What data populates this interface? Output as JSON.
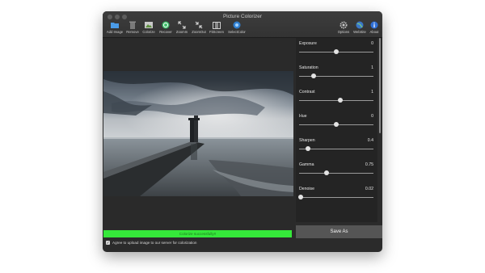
{
  "window": {
    "title": "Picture Colorizer"
  },
  "toolbar": {
    "items": [
      {
        "label": "Add Image",
        "icon": "folder-icon"
      },
      {
        "label": "Remove",
        "icon": "trash-icon"
      },
      {
        "label": "Colorize",
        "icon": "picture-icon"
      },
      {
        "label": "Recover",
        "icon": "recover-icon"
      },
      {
        "label": "ZoomIn",
        "icon": "zoom-in-icon"
      },
      {
        "label": "ZoomOut",
        "icon": "zoom-out-icon"
      },
      {
        "label": "FitScreen",
        "icon": "fit-screen-icon"
      },
      {
        "label": "SelectColor",
        "icon": "select-color-icon"
      },
      {
        "label": "Options",
        "icon": "gear-icon"
      },
      {
        "label": "WebSite",
        "icon": "globe-icon"
      },
      {
        "label": "About",
        "icon": "info-icon"
      }
    ]
  },
  "adjustments": [
    {
      "name": "Exposure",
      "value": "0",
      "position": 0.5
    },
    {
      "name": "Saturation",
      "value": "1",
      "position": 0.2
    },
    {
      "name": "Contrast",
      "value": "1",
      "position": 0.55
    },
    {
      "name": "Hue",
      "value": "0",
      "position": 0.5
    },
    {
      "name": "Sharpen",
      "value": "0.4",
      "position": 0.12
    },
    {
      "name": "Gamma",
      "value": "0.75",
      "position": 0.37
    },
    {
      "name": "Denoise",
      "value": "0.02",
      "position": 0.02
    }
  ],
  "status": {
    "text": "Colorize successfully!!",
    "color": "#35e83a"
  },
  "save_button": {
    "label": "Save As"
  },
  "agree": {
    "text": "Agree to upload image to our server for colorization",
    "checked": true
  }
}
